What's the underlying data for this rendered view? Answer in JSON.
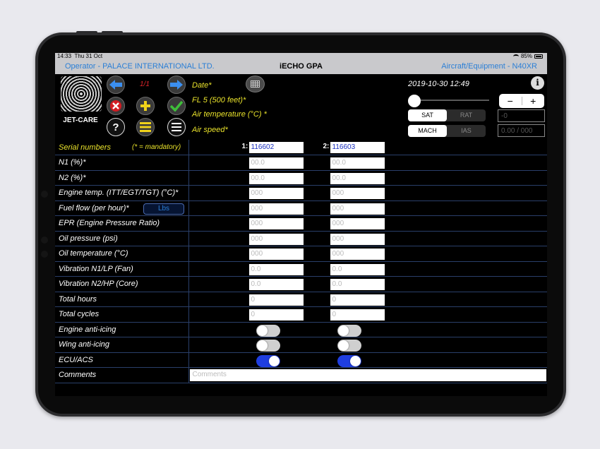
{
  "status": {
    "time": "14:33",
    "date": "Thu 31 Oct",
    "battery": "85%"
  },
  "titlebar": {
    "operator": "Operator - PALACE INTERNATIONAL LTD.",
    "app": "iECHO GPA",
    "aircraft": "Aircraft/Equipment - N40XR"
  },
  "logo": {
    "brand": "JET-CARE"
  },
  "toolbar": {
    "page_indicator": "1/1",
    "icons": [
      "back-arrow-icon",
      "forward-arrow-icon",
      "delete-icon",
      "add-icon",
      "confirm-icon",
      "help-icon",
      "list-icon",
      "menu-icon"
    ],
    "help_symbol": "?"
  },
  "flight": {
    "date_label": "Date*",
    "fl_label": "FL 5 (500 feet)*",
    "air_temp_label": "Air temperature (°C) *",
    "air_speed_label": "Air speed*",
    "datetime": "2019-10-30 12:49",
    "slider_value": 0,
    "temp_value_placeholder": "-0",
    "temp_modes": [
      "SAT",
      "RAT"
    ],
    "temp_mode_selected": "SAT",
    "speed_modes": [
      "MACH",
      "IAS"
    ],
    "speed_mode_selected": "MACH",
    "speed_placeholder": "0.00 / 000",
    "stepper_minus": "−",
    "stepper_plus": "+"
  },
  "serial": {
    "label": "Serial numbers",
    "mandatory_note": "(* = mandatory)",
    "engine1_num": "1:",
    "engine2_num": "2:",
    "engine1": "116602",
    "engine2": "116603"
  },
  "rows": [
    {
      "label": "N1 (%)*",
      "p1": "00.0",
      "p2": "00.0"
    },
    {
      "label": "N2 (%)*",
      "p1": "00.0",
      "p2": "00.0"
    },
    {
      "label": "Engine temp. (ITT/EGT/TGT) (°C)*",
      "p1": "000",
      "p2": "000"
    },
    {
      "label": "Fuel flow (per hour)*",
      "p1": "000",
      "p2": "000",
      "unit": "Lbs"
    },
    {
      "label": "EPR (Engine Pressure Ratio)",
      "p1": "000",
      "p2": "000"
    },
    {
      "label": "Oil pressure (psi)",
      "p1": "000",
      "p2": "000"
    },
    {
      "label": "Oil temperature (°C)",
      "p1": "000",
      "p2": "000"
    },
    {
      "label": "Vibration N1/LP (Fan)",
      "p1": "0.0",
      "p2": "0.0"
    },
    {
      "label": "Vibration N2/HP (Core)",
      "p1": "0.0",
      "p2": "0.0"
    },
    {
      "label": "Total hours",
      "p1": "0",
      "p2": "0"
    },
    {
      "label": "Total cycles",
      "p1": "0",
      "p2": "0"
    }
  ],
  "toggles": [
    {
      "label": "Engine anti-icing",
      "e1": false,
      "e2": false
    },
    {
      "label": "Wing anti-icing",
      "e1": false,
      "e2": false
    },
    {
      "label": "ECU/ACS",
      "e1": true,
      "e2": true
    }
  ],
  "comments": {
    "label": "Comments",
    "placeholder": "Comments"
  },
  "colors": {
    "accent_blue": "#2b7fd6",
    "label_yellow": "#e9e22b",
    "toggle_on": "#1f3ee0",
    "page_red": "#e0242a"
  }
}
